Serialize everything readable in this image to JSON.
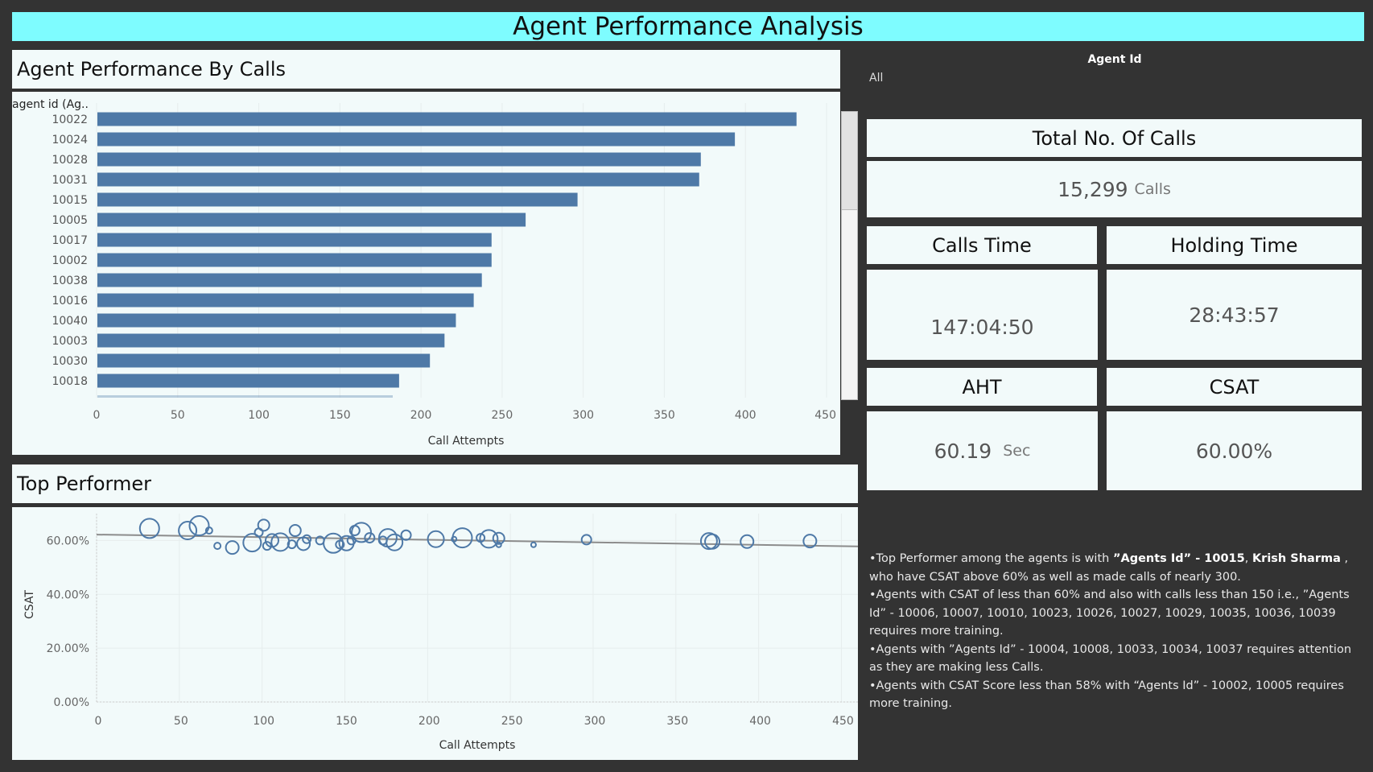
{
  "header": {
    "title": "Agent Performance Analysis"
  },
  "bar_panel": {
    "title": "Agent Performance By Calls",
    "axis_header": "agent id (Ag.."
  },
  "scatter_panel": {
    "title": "Top Performer"
  },
  "filter": {
    "label": "Agent Id",
    "value": "All"
  },
  "kpis": {
    "total_calls": {
      "label": "Total No. Of Calls",
      "value": "15,299",
      "unit": "Calls"
    },
    "calls_time": {
      "label": "Calls Time",
      "value": "147:04:50"
    },
    "holding_time": {
      "label": "Holding Time",
      "value": "28:43:57"
    },
    "aht": {
      "label": "AHT",
      "value": "60.19",
      "unit": "Sec"
    },
    "csat": {
      "label": "CSAT",
      "value": "60.00%"
    }
  },
  "insights": {
    "l1a": "•Top Performer among the agents is with ",
    "l1b": "”Agents Id” - 10015",
    "l1c": ", ",
    "l1d": "Krish Sharma",
    "l1e": " , who have CSAT above 60% as well as made calls of nearly 300.",
    "l2": "•Agents with CSAT of less than 60% and also with calls less than 150 i.e., ”Agents Id” - 10006, 10007, 10010, 10023, 10026, 10027, 10029, 10035, 10036, 10039 requires more training.",
    "l3": "•Agents with ”Agents Id” - 10004, 10008, 10033, 10034, 10037 requires attention as they are making less Calls.",
    "l4": "•Agents with CSAT Score less than 58% with “Agents Id” - 10002, 10005 requires more training."
  },
  "colors": {
    "bar": "#4e79a7",
    "header_bg": "#7efcff",
    "panel_bg": "#f2fafa",
    "page_bg": "#333333"
  },
  "chart_data": [
    {
      "type": "bar",
      "orientation": "horizontal",
      "title": "Agent Performance By Calls",
      "categories": [
        "10022",
        "10024",
        "10028",
        "10031",
        "10015",
        "10005",
        "10017",
        "10002",
        "10038",
        "10016",
        "10040",
        "10003",
        "10030",
        "10018"
      ],
      "values": [
        431,
        393,
        372,
        371,
        296,
        264,
        243,
        243,
        237,
        232,
        221,
        214,
        205,
        186
      ],
      "xlabel": "Call Attempts",
      "ylabel": "agent id (Ag..",
      "xlim": [
        0,
        450
      ],
      "xticks": [
        0,
        50,
        100,
        150,
        200,
        250,
        300,
        350,
        400,
        450
      ]
    },
    {
      "type": "scatter",
      "title": "Top Performer",
      "xlabel": "Call Attempts",
      "ylabel": "CSAT",
      "xlim": [
        0,
        460
      ],
      "ylim": [
        0,
        0.7
      ],
      "xticks": [
        0,
        50,
        100,
        150,
        200,
        250,
        300,
        350,
        400,
        450
      ],
      "yticks": [
        0,
        0.2,
        0.4,
        0.6
      ],
      "ytick_labels": [
        "0.00%",
        "20.00%",
        "40.00%",
        "60.00%"
      ],
      "trend_line": {
        "x": [
          0,
          460
        ],
        "y": [
          0.622,
          0.578
        ]
      },
      "points": [
        {
          "x": 32,
          "y": 0.645,
          "s": 12
        },
        {
          "x": 55,
          "y": 0.637,
          "s": 11
        },
        {
          "x": 62,
          "y": 0.655,
          "s": 12
        },
        {
          "x": 68,
          "y": 0.637,
          "s": 4
        },
        {
          "x": 73,
          "y": 0.58,
          "s": 4
        },
        {
          "x": 82,
          "y": 0.574,
          "s": 8
        },
        {
          "x": 94,
          "y": 0.592,
          "s": 11
        },
        {
          "x": 98,
          "y": 0.63,
          "s": 5
        },
        {
          "x": 101,
          "y": 0.657,
          "s": 7
        },
        {
          "x": 103,
          "y": 0.58,
          "s": 5
        },
        {
          "x": 106,
          "y": 0.6,
          "s": 8
        },
        {
          "x": 111,
          "y": 0.594,
          "s": 11
        },
        {
          "x": 118,
          "y": 0.586,
          "s": 5
        },
        {
          "x": 120,
          "y": 0.637,
          "s": 7
        },
        {
          "x": 125,
          "y": 0.588,
          "s": 8
        },
        {
          "x": 127,
          "y": 0.605,
          "s": 5
        },
        {
          "x": 135,
          "y": 0.6,
          "s": 5
        },
        {
          "x": 143,
          "y": 0.59,
          "s": 12
        },
        {
          "x": 147,
          "y": 0.585,
          "s": 5
        },
        {
          "x": 151,
          "y": 0.59,
          "s": 9
        },
        {
          "x": 154,
          "y": 0.6,
          "s": 5
        },
        {
          "x": 156,
          "y": 0.637,
          "s": 6
        },
        {
          "x": 160,
          "y": 0.63,
          "s": 12
        },
        {
          "x": 165,
          "y": 0.61,
          "s": 6
        },
        {
          "x": 173,
          "y": 0.6,
          "s": 5
        },
        {
          "x": 176,
          "y": 0.61,
          "s": 11
        },
        {
          "x": 180,
          "y": 0.593,
          "s": 10
        },
        {
          "x": 187,
          "y": 0.62,
          "s": 6
        },
        {
          "x": 205,
          "y": 0.605,
          "s": 10
        },
        {
          "x": 216,
          "y": 0.605,
          "s": 3
        },
        {
          "x": 221,
          "y": 0.61,
          "s": 12
        },
        {
          "x": 232,
          "y": 0.61,
          "s": 5
        },
        {
          "x": 237,
          "y": 0.606,
          "s": 11
        },
        {
          "x": 243,
          "y": 0.608,
          "s": 7
        },
        {
          "x": 243,
          "y": 0.584,
          "s": 3
        },
        {
          "x": 264,
          "y": 0.584,
          "s": 3
        },
        {
          "x": 296,
          "y": 0.603,
          "s": 6
        },
        {
          "x": 370,
          "y": 0.598,
          "s": 10
        },
        {
          "x": 372,
          "y": 0.596,
          "s": 9
        },
        {
          "x": 393,
          "y": 0.596,
          "s": 8
        },
        {
          "x": 431,
          "y": 0.598,
          "s": 8
        }
      ]
    }
  ]
}
